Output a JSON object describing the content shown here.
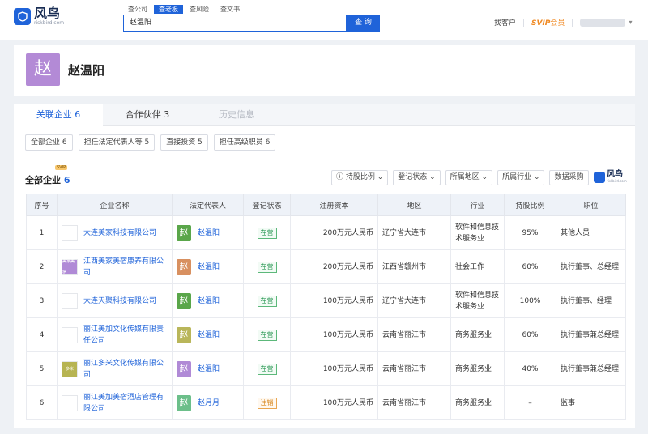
{
  "header": {
    "logo_text": "风鸟",
    "logo_sub": "riskbird.com",
    "search_tabs": [
      {
        "label": "查公司",
        "active": false
      },
      {
        "label": "查老板",
        "active": true
      },
      {
        "label": "查风险",
        "active": false
      },
      {
        "label": "查文书",
        "active": false
      }
    ],
    "search_value": "赵温阳",
    "search_button": "查 询",
    "find_customer": "找客户",
    "svip_label": "SVIP",
    "member_label": "会员"
  },
  "profile": {
    "avatar_char": "赵",
    "name": "赵温阳"
  },
  "tabs": [
    {
      "label": "关联企业 6",
      "state": "active"
    },
    {
      "label": "合作伙伴 3",
      "state": "normal"
    },
    {
      "label": "历史信息",
      "state": "disabled"
    }
  ],
  "filters": [
    "全部企业 6",
    "担任法定代表人等 5",
    "直接投资 5",
    "担任高级职员 6"
  ],
  "section": {
    "title": "全部企业",
    "count": "6",
    "vip_tag": "SVIP"
  },
  "toolbar": {
    "dropdowns": [
      "ⓘ 持股比例 ⌄",
      "登记状态 ⌄",
      "所属地区 ⌄",
      "所属行业 ⌄"
    ],
    "purchase_button": "数据采购",
    "mini_logo_text": "风鸟",
    "mini_logo_sub": "riskbird.com"
  },
  "table": {
    "columns": [
      "序号",
      "企业名称",
      "法定代表人",
      "登记状态",
      "注册资本",
      "地区",
      "行业",
      "持股比例",
      "职位"
    ],
    "rows": [
      {
        "no": "1",
        "company": "大连美家科技有限公司",
        "logo_color": "#ffffff",
        "logo_text": "",
        "rep": "赵温阳",
        "rep_char": "赵",
        "rep_color": "#5aa64a",
        "status": "在营",
        "status_type": "active",
        "capital": "200万元人民币",
        "region": "辽宁省大连市",
        "industry": "软件和信息技术服务业",
        "share": "95%",
        "position": "其他人员"
      },
      {
        "no": "2",
        "company": "江西美家美宿康养有限公司",
        "logo_color": "#b08ad6",
        "logo_text": "美家美宿",
        "rep": "赵温阳",
        "rep_char": "赵",
        "rep_color": "#d89060",
        "status": "在营",
        "status_type": "active",
        "capital": "200万元人民币",
        "region": "江西省赣州市",
        "industry": "社会工作",
        "share": "60%",
        "position": "执行董事、总经理"
      },
      {
        "no": "3",
        "company": "大连天聚科技有限公司",
        "logo_color": "#ffffff",
        "logo_text": "",
        "rep": "赵温阳",
        "rep_char": "赵",
        "rep_color": "#5aa64a",
        "status": "在营",
        "status_type": "active",
        "capital": "100万元人民币",
        "region": "辽宁省大连市",
        "industry": "软件和信息技术服务业",
        "share": "100%",
        "position": "执行董事、经理"
      },
      {
        "no": "4",
        "company": "丽江美加文化传媒有限责任公司",
        "logo_color": "#ffffff",
        "logo_text": "",
        "rep": "赵温阳",
        "rep_char": "赵",
        "rep_color": "#b9b65a",
        "status": "在营",
        "status_type": "active",
        "capital": "100万元人民币",
        "region": "云南省丽江市",
        "industry": "商务服务业",
        "share": "60%",
        "position": "执行董事兼总经理"
      },
      {
        "no": "5",
        "company": "丽江多米文化传媒有限公司",
        "logo_color": "#b7b452",
        "logo_text": "多米",
        "rep": "赵温阳",
        "rep_char": "赵",
        "rep_color": "#b08ad6",
        "status": "在营",
        "status_type": "active",
        "capital": "100万元人民币",
        "region": "云南省丽江市",
        "industry": "商务服务业",
        "share": "40%",
        "position": "执行董事兼总经理"
      },
      {
        "no": "6",
        "company": "丽江美加美宿酒店管理有限公司",
        "logo_color": "#ffffff",
        "logo_text": "",
        "rep": "赵月月",
        "rep_char": "赵",
        "rep_color": "#6cbf8a",
        "status": "注销",
        "status_type": "cancel",
        "capital": "100万元人民币",
        "region": "云南省丽江市",
        "industry": "商务服务业",
        "share": "–",
        "position": "监事"
      }
    ]
  }
}
